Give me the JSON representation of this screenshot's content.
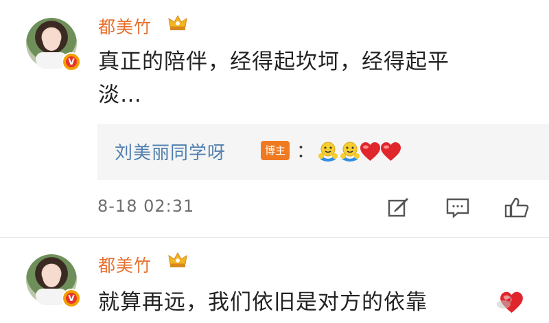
{
  "comments": [
    {
      "username": "都美竹",
      "text_line1": "真正的陪伴，经得起坎坷，经得起平",
      "text_line2": "淡…"
    },
    {
      "username": "都美竹",
      "text_line1": "就算再远，我们依旧是对方的依靠"
    }
  ],
  "reply": {
    "username": "刘美丽同学呀",
    "badge": "博主",
    "colon": "："
  },
  "meta": {
    "timestamp": "8-18 02:31"
  },
  "icons": {
    "edit": "edit-icon",
    "comment": "comment-icon",
    "like": "thumbs-up-icon",
    "verified": "verified-v-badge",
    "crown": "crown-icon",
    "hug_emoji": "hug-emoji",
    "heart": "heart-emoji"
  },
  "colors": {
    "username": "#e8702e",
    "reply_name": "#4f7faf",
    "blogger_tag": "#f07a20",
    "heart": "#e0252c"
  }
}
